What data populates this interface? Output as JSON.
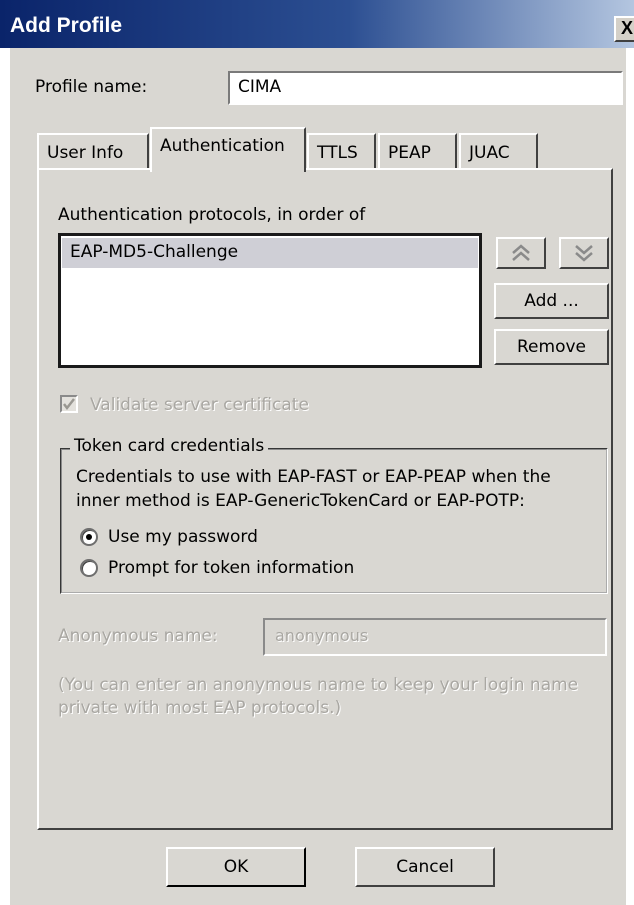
{
  "window": {
    "title": "Add Profile",
    "close_glyph": "X"
  },
  "profile": {
    "label": "Profile name:",
    "value": "CIMA"
  },
  "tabs": [
    {
      "label": "User Info"
    },
    {
      "label": "Authentication",
      "selected": true
    },
    {
      "label": "TTLS"
    },
    {
      "label": "PEAP"
    },
    {
      "label": "JUAC"
    }
  ],
  "authentication": {
    "protocols_label": "Authentication protocols, in order of",
    "protocols": [
      "EAP-MD5-Challenge"
    ],
    "add_label": "Add ...",
    "remove_label": "Remove",
    "move_up_icon": "double-chevron-up-icon",
    "move_down_icon": "double-chevron-down-icon",
    "validate_label": "Validate server certificate",
    "validate_checked": true,
    "token_group": {
      "legend": "Token card credentials",
      "desc_line1": "Credentials to use with EAP-FAST or EAP-PEAP when the",
      "desc_line2": "inner method is EAP-GenericTokenCard or EAP-POTP:",
      "options": [
        {
          "label": "Use my password",
          "selected": true
        },
        {
          "label": "Prompt for token information",
          "selected": false
        }
      ]
    },
    "anonymous": {
      "label": "Anonymous name:",
      "value": "anonymous",
      "hint_line1": "(You can enter an anonymous name to keep your login name",
      "hint_line2": "private with most EAP protocols.)"
    }
  },
  "footer": {
    "ok_label": "OK",
    "cancel_label": "Cancel"
  },
  "colors": {
    "titlebar_start": "#0a246a",
    "titlebar_end": "#b4c6e0",
    "dialog_bg": "#d9d7d2",
    "selection_bg": "#cfcfd6",
    "disabled_text": "#a9a7a2"
  }
}
